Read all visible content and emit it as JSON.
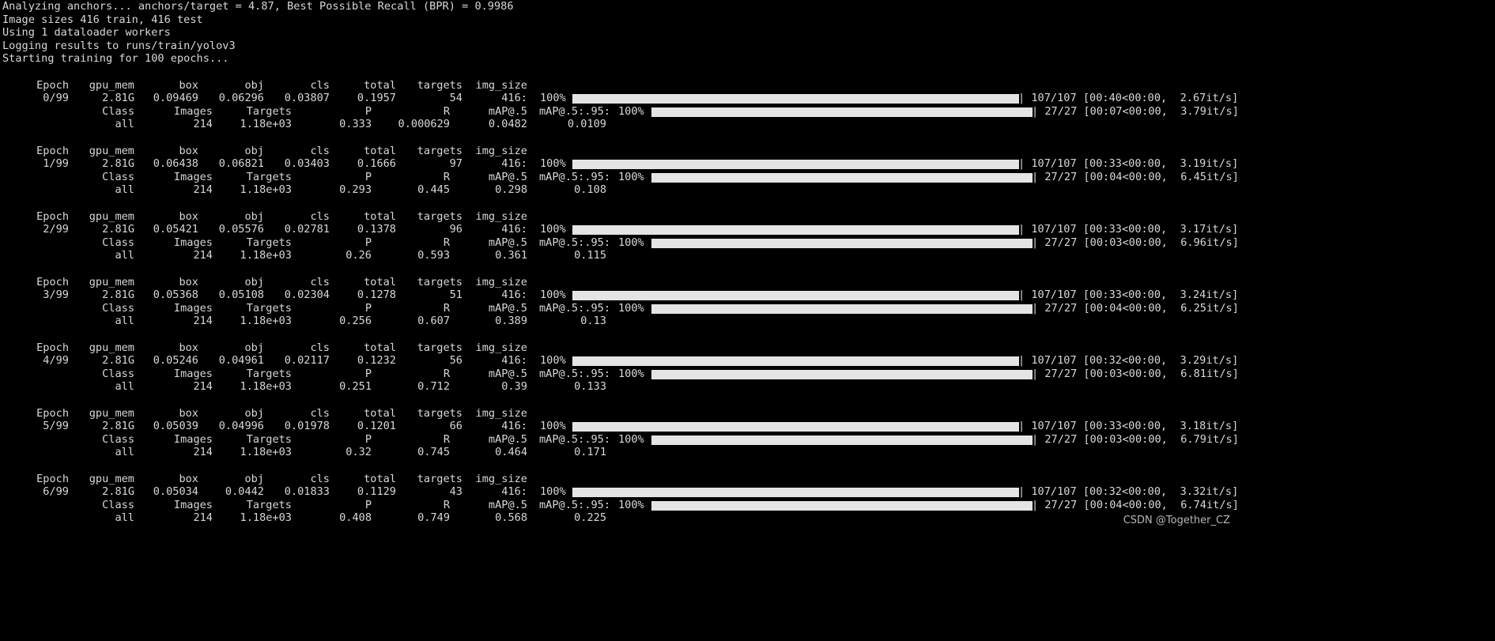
{
  "intro": [
    "Analyzing anchors... anchors/target = 4.87, Best Possible Recall (BPR) = 0.9986",
    "Image sizes 416 train, 416 test",
    "Using 1 dataloader workers",
    "Logging results to runs/train/yolov3",
    "Starting training for 100 epochs..."
  ],
  "train_headers": [
    "Epoch",
    "gpu_mem",
    "box",
    "obj",
    "cls",
    "total",
    "targets",
    "img_size"
  ],
  "val_headers": [
    "Class",
    "Images",
    "Targets",
    "P",
    "R",
    "mAP@.5",
    "mAP@.5:.95:"
  ],
  "epochs": [
    {
      "train": [
        "0/99",
        "2.81G",
        "0.09469",
        "0.06296",
        "0.03807",
        "0.1957",
        "54",
        "416:"
      ],
      "train_pct": "100%",
      "train_tail": "| 107/107 [00:40<00:00,  2.67it/s]",
      "val_pct": "100%",
      "val_tail": "| 27/27 [00:07<00:00,  3.79it/s]",
      "all": [
        "all",
        "214",
        "1.18e+03",
        "0.333",
        "0.000629",
        "0.0482",
        "0.0109"
      ]
    },
    {
      "train": [
        "1/99",
        "2.81G",
        "0.06438",
        "0.06821",
        "0.03403",
        "0.1666",
        "97",
        "416:"
      ],
      "train_pct": "100%",
      "train_tail": "| 107/107 [00:33<00:00,  3.19it/s]",
      "val_pct": "100%",
      "val_tail": "| 27/27 [00:04<00:00,  6.45it/s]",
      "all": [
        "all",
        "214",
        "1.18e+03",
        "0.293",
        "0.445",
        "0.298",
        "0.108"
      ]
    },
    {
      "train": [
        "2/99",
        "2.81G",
        "0.05421",
        "0.05576",
        "0.02781",
        "0.1378",
        "96",
        "416:"
      ],
      "train_pct": "100%",
      "train_tail": "| 107/107 [00:33<00:00,  3.17it/s]",
      "val_pct": "100%",
      "val_tail": "| 27/27 [00:03<00:00,  6.96it/s]",
      "all": [
        "all",
        "214",
        "1.18e+03",
        "0.26",
        "0.593",
        "0.361",
        "0.115"
      ]
    },
    {
      "train": [
        "3/99",
        "2.81G",
        "0.05368",
        "0.05108",
        "0.02304",
        "0.1278",
        "51",
        "416:"
      ],
      "train_pct": "100%",
      "train_tail": "| 107/107 [00:33<00:00,  3.24it/s]",
      "val_pct": "100%",
      "val_tail": "| 27/27 [00:04<00:00,  6.25it/s]",
      "all": [
        "all",
        "214",
        "1.18e+03",
        "0.256",
        "0.607",
        "0.389",
        "0.13"
      ]
    },
    {
      "train": [
        "4/99",
        "2.81G",
        "0.05246",
        "0.04961",
        "0.02117",
        "0.1232",
        "56",
        "416:"
      ],
      "train_pct": "100%",
      "train_tail": "| 107/107 [00:32<00:00,  3.29it/s]",
      "val_pct": "100%",
      "val_tail": "| 27/27 [00:03<00:00,  6.81it/s]",
      "all": [
        "all",
        "214",
        "1.18e+03",
        "0.251",
        "0.712",
        "0.39",
        "0.133"
      ]
    },
    {
      "train": [
        "5/99",
        "2.81G",
        "0.05039",
        "0.04996",
        "0.01978",
        "0.1201",
        "66",
        "416:"
      ],
      "train_pct": "100%",
      "train_tail": "| 107/107 [00:33<00:00,  3.18it/s]",
      "val_pct": "100%",
      "val_tail": "| 27/27 [00:03<00:00,  6.79it/s]",
      "all": [
        "all",
        "214",
        "1.18e+03",
        "0.32",
        "0.745",
        "0.464",
        "0.171"
      ]
    },
    {
      "train": [
        "6/99",
        "2.81G",
        "0.05034",
        "0.0442",
        "0.01833",
        "0.1129",
        "43",
        "416:"
      ],
      "train_pct": "100%",
      "train_tail": "| 107/107 [00:32<00:00,  3.32it/s]",
      "val_pct": "100%",
      "val_tail": "| 27/27 [00:04<00:00,  6.74it/s]",
      "all": [
        "all",
        "214",
        "1.18e+03",
        "0.408",
        "0.749",
        "0.568",
        "0.225"
      ]
    }
  ],
  "watermark": "CSDN @Together_CZ"
}
